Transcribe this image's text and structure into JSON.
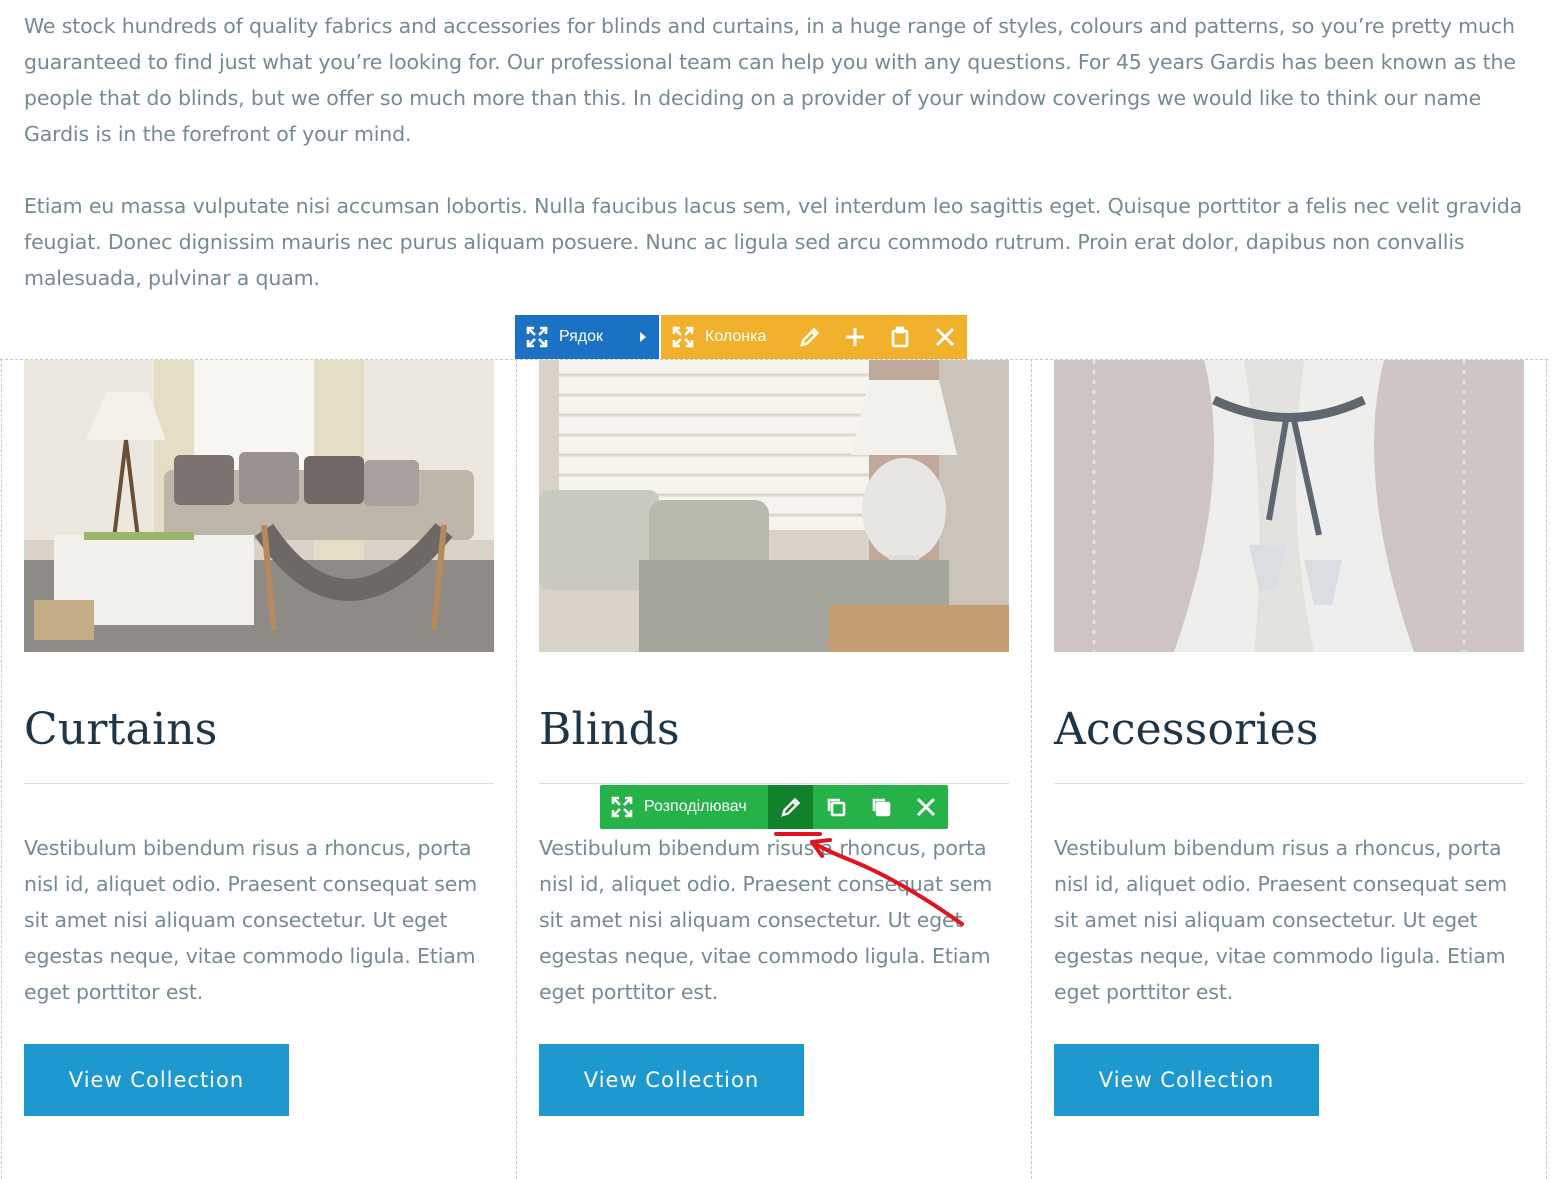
{
  "intro": {
    "paragraph1": "We stock hundreds of quality fabrics and accessories for blinds and curtains, in a huge range of styles, colours and patterns, so you’re pretty much guaranteed to find just what you’re looking for. Our professional team can help you with any questions. For 45 years Gardis has been known as the people that do blinds, but we offer so much more than this. In deciding on a provider of your window coverings we would like to think our name Gardis is in the forefront of your mind.",
    "paragraph2": "Etiam eu massa vulputate nisi accumsan lobortis. Nulla faucibus lacus sem, vel interdum leo sagittis eget. Quisque porttitor a felis nec velit gravida feugiat. Donec dignissim mauris nec purus aliquam posuere. Nunc ac ligula sed arcu commodo rutrum. Proin erat dolor, dapibus non convallis malesuada, pulvinar a quam."
  },
  "editor": {
    "row_label": "Рядок",
    "column_label": "Колонка",
    "divider_label": "Розподілювач"
  },
  "columns": [
    {
      "title": "Curtains",
      "text": "Vestibulum bibendum risus a rhoncus, porta nisl id, aliquet odio. Praesent consequat sem sit amet nisi aliquam consectetur. Ut eget egestas neque, vitae commodo ligula. Etiam eget porttitor est.",
      "button": "View Collection"
    },
    {
      "title": "Blinds",
      "text": "Vestibulum bibendum risus a rhoncus, porta nisl id, aliquet odio. Praesent consequat sem sit amet nisi aliquam consectetur. Ut eget egestas neque, vitae commodo ligula. Etiam eget porttitor est.",
      "button": "View Collection"
    },
    {
      "title": "Accessories",
      "text": "Vestibulum bibendum risus a rhoncus, porta nisl id, aliquet odio. Praesent consequat sem sit amet nisi aliquam consectetur. Ut eget egestas neque, vitae commodo ligula. Etiam eget porttitor est.",
      "button": "View Collection"
    }
  ],
  "colors": {
    "row_toolbar": "#1b72c4",
    "column_toolbar": "#f2b12c",
    "divider_toolbar": "#25b248",
    "button": "#1e99d0",
    "annotation": "#e0141e"
  }
}
